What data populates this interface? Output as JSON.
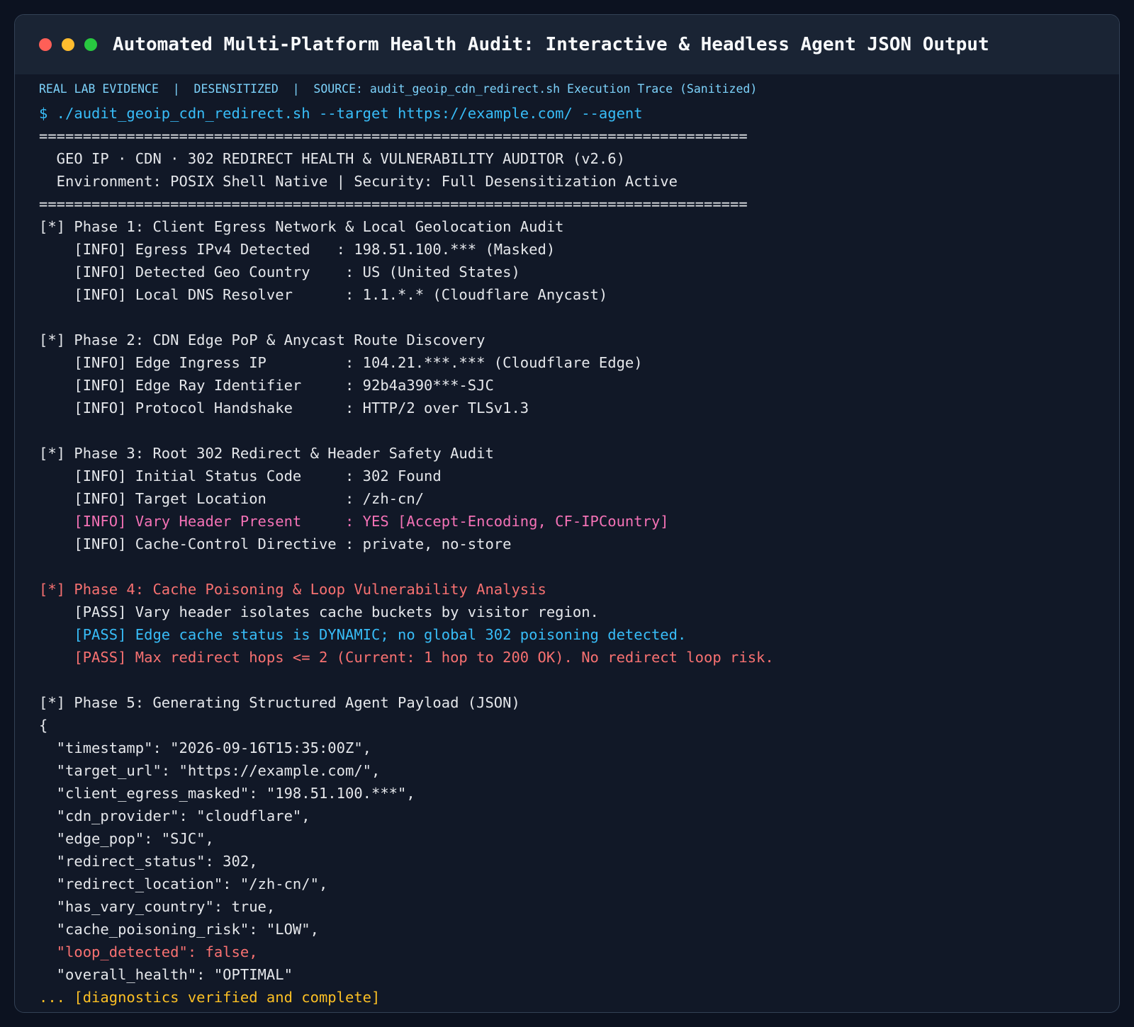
{
  "window": {
    "title": "Automated Multi-Platform Health Audit: Interactive & Headless Agent JSON Output",
    "banner": "REAL LAB EVIDENCE  |  DESENSITIZED  |  SOURCE: audit_geoip_cdn_redirect.sh Execution Trace (Sanitized)"
  },
  "colors": {
    "default": "#e5e7eb",
    "command": "#38bdf8",
    "highlight_pink": "#f472b6",
    "highlight_red": "#f87171",
    "highlight_blue": "#38bdf8",
    "footer_yellow": "#fbbf24"
  },
  "terminal": {
    "lines": [
      {
        "text": "$ ./audit_geoip_cdn_redirect.sh --target https://example.com/ --agent",
        "style": "cmd"
      },
      {
        "text": "=================================================================================",
        "style": "default"
      },
      {
        "text": "  GEO IP · CDN · 302 REDIRECT HEALTH & VULNERABILITY AUDITOR (v2.6)",
        "style": "default"
      },
      {
        "text": "  Environment: POSIX Shell Native | Security: Full Desensitization Active",
        "style": "default"
      },
      {
        "text": "=================================================================================",
        "style": "default"
      },
      {
        "text": "[*] Phase 1: Client Egress Network & Local Geolocation Audit",
        "style": "default"
      },
      {
        "text": "    [INFO] Egress IPv4 Detected   : 198.51.100.*** (Masked)",
        "style": "default"
      },
      {
        "text": "    [INFO] Detected Geo Country    : US (United States)",
        "style": "default"
      },
      {
        "text": "    [INFO] Local DNS Resolver      : 1.1.*.* (Cloudflare Anycast)",
        "style": "default"
      },
      {
        "text": "",
        "style": "default"
      },
      {
        "text": "[*] Phase 2: CDN Edge PoP & Anycast Route Discovery",
        "style": "default"
      },
      {
        "text": "    [INFO] Edge Ingress IP         : 104.21.***.*** (Cloudflare Edge)",
        "style": "default"
      },
      {
        "text": "    [INFO] Edge Ray Identifier     : 92b4a390***-SJC",
        "style": "default"
      },
      {
        "text": "    [INFO] Protocol Handshake      : HTTP/2 over TLSv1.3",
        "style": "default"
      },
      {
        "text": "",
        "style": "default"
      },
      {
        "text": "[*] Phase 3: Root 302 Redirect & Header Safety Audit",
        "style": "default"
      },
      {
        "text": "    [INFO] Initial Status Code     : 302 Found",
        "style": "default"
      },
      {
        "text": "    [INFO] Target Location         : /zh-cn/",
        "style": "default"
      },
      {
        "text": "    [INFO] Vary Header Present     : YES [Accept-Encoding, CF-IPCountry]",
        "style": "pink"
      },
      {
        "text": "    [INFO] Cache-Control Directive : private, no-store",
        "style": "default"
      },
      {
        "text": "",
        "style": "default"
      },
      {
        "text": "[*] Phase 4: Cache Poisoning & Loop Vulnerability Analysis",
        "style": "red"
      },
      {
        "text": "    [PASS] Vary header isolates cache buckets by visitor region.",
        "style": "default"
      },
      {
        "text": "    [PASS] Edge cache status is DYNAMIC; no global 302 poisoning detected.",
        "style": "blue"
      },
      {
        "text": "    [PASS] Max redirect hops <= 2 (Current: 1 hop to 200 OK). No redirect loop risk.",
        "style": "red"
      },
      {
        "text": "",
        "style": "default"
      },
      {
        "text": "[*] Phase 5: Generating Structured Agent Payload (JSON)",
        "style": "default"
      },
      {
        "text": "{",
        "style": "default"
      },
      {
        "text": "  \"timestamp\": \"2026-09-16T15:35:00Z\",",
        "style": "default"
      },
      {
        "text": "  \"target_url\": \"https://example.com/\",",
        "style": "default"
      },
      {
        "text": "  \"client_egress_masked\": \"198.51.100.***\",",
        "style": "default"
      },
      {
        "text": "  \"cdn_provider\": \"cloudflare\",",
        "style": "default"
      },
      {
        "text": "  \"edge_pop\": \"SJC\",",
        "style": "default"
      },
      {
        "text": "  \"redirect_status\": 302,",
        "style": "default"
      },
      {
        "text": "  \"redirect_location\": \"/zh-cn/\",",
        "style": "default"
      },
      {
        "text": "  \"has_vary_country\": true,",
        "style": "default"
      },
      {
        "text": "  \"cache_poisoning_risk\": \"LOW\",",
        "style": "default"
      },
      {
        "text": "  \"loop_detected\": false,",
        "style": "red"
      },
      {
        "text": "  \"overall_health\": \"OPTIMAL\"",
        "style": "default"
      },
      {
        "text": "... [diagnostics verified and complete]",
        "style": "yellow"
      }
    ]
  }
}
